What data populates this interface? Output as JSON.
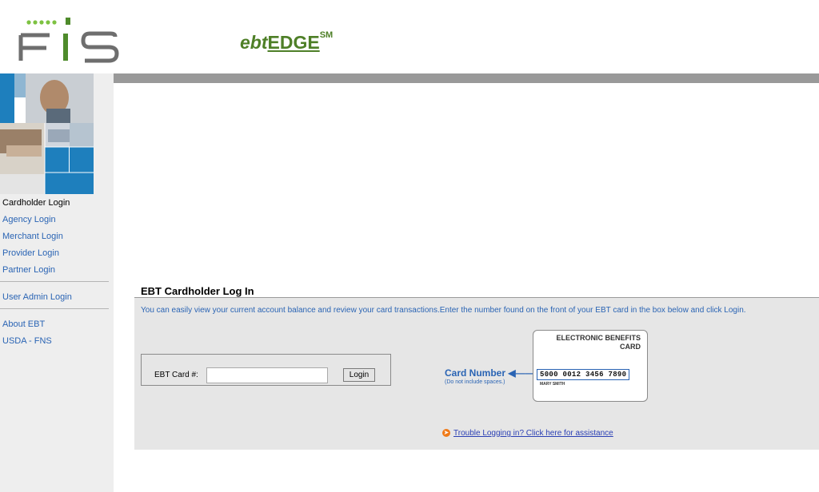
{
  "header": {
    "brand_ebt": "ebt",
    "brand_edge": "EDGE",
    "brand_sm": "SM",
    "logo_text": "FIS"
  },
  "sidebar": {
    "items": [
      {
        "label": "Cardholder Login",
        "active": true
      },
      {
        "label": "Agency Login"
      },
      {
        "label": "Merchant Login"
      },
      {
        "label": "Provider Login"
      },
      {
        "label": "Partner Login"
      },
      {
        "label": "User Admin Login"
      },
      {
        "label": "About EBT"
      },
      {
        "label": "USDA - FNS"
      }
    ]
  },
  "login": {
    "title": "EBT Cardholder Log In",
    "description": "You can easily view your current account balance and review your card transactions.Enter the number found on the front of your EBT card in the box below and click Login.",
    "card_label": "EBT Card #:",
    "card_value": "",
    "button_label": "Login"
  },
  "card_illustration": {
    "number_label": "Card Number",
    "note": "(Do not include spaces.)",
    "title_line1": "ELECTRONIC BENEFITS",
    "title_line2": "CARD",
    "sample_number": "5000 0012 3456 7890",
    "sample_name": "MARY SMITH"
  },
  "help": {
    "trouble_link": "Trouble Logging in? Click here for assistance"
  },
  "colors": {
    "brand_green": "#4e7f27",
    "link_blue": "#2a64b4",
    "panel_grey": "#e6e6e6",
    "bar_grey": "#999999",
    "tile_blue": "#1e7fbd"
  }
}
